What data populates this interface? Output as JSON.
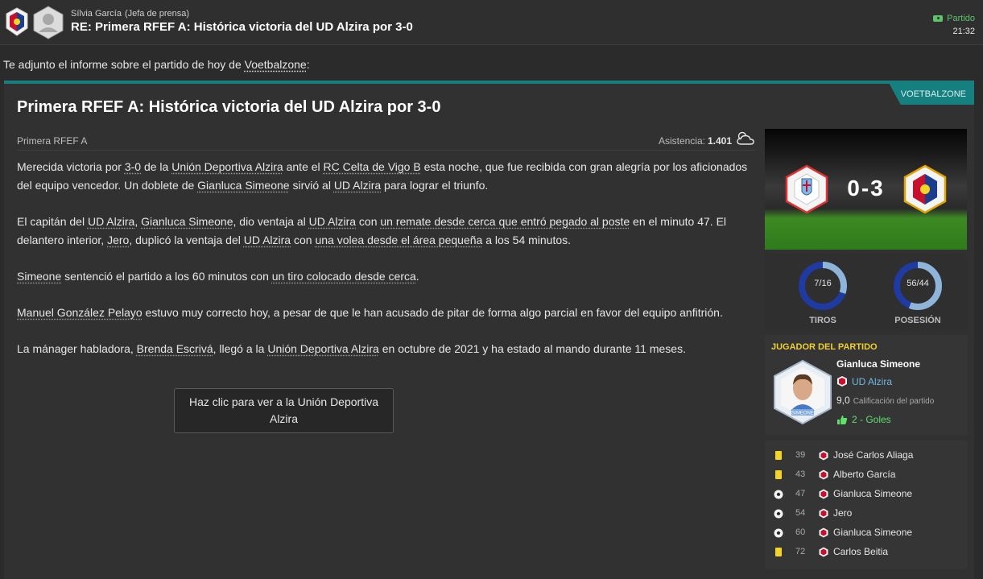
{
  "header": {
    "sender_name": "Sílvia García",
    "sender_role": "(Jefa de prensa)",
    "subject": "RE: Primera RFEF A: Histórica victoria del UD Alzira por 3-0",
    "category": "Partido",
    "time": "21:32"
  },
  "intro": {
    "prefix": "Te adjunto el informe sobre el partido de hoy de ",
    "source_link": "Voetbalzone",
    "suffix": ":"
  },
  "article": {
    "source_tab": "VOETBALZONE",
    "headline": "Primera RFEF A: Histórica victoria del UD Alzira por 3-0",
    "competition": "Primera RFEF A",
    "attendance_label": "Asistencia:",
    "attendance_value": "1.401",
    "weather_icon": "partly-cloudy-icon",
    "p1": {
      "a": "Merecida victoria por ",
      "l1": "3-0",
      "b": " de la ",
      "l2": "Unión Deportiva Alzira",
      "c": " ante el ",
      "l3": "RC Celta de Vigo B",
      "d": " esta noche, que fue recibida con gran alegría por los aficionados del equipo vencedor. Un doblete de ",
      "l4": "Gianluca Simeone",
      "e": " sirvió al ",
      "l5": "UD Alzira",
      "f": " para lograr el triunfo."
    },
    "p2": {
      "a": "El capitán del ",
      "l1": "UD Alzira",
      "b": ", ",
      "l2": "Gianluca Simeone",
      "c": ", dio ventaja al ",
      "l3": "UD Alzira",
      "d": " con ",
      "l4": "un remate desde cerca que entró pegado al poste",
      "e": " en el minuto 47. El delantero interior, ",
      "l5": "Jero",
      "f": ", duplicó la ventaja del ",
      "l6": "UD Alzira",
      "g": " con ",
      "l7": "una volea desde el área pequeña",
      "h": " a los 54 minutos."
    },
    "p3": {
      "l1": "Simeone",
      "a": " sentenció el partido a los 60 minutos con ",
      "l2": "un tiro colocado desde cerca",
      "b": "."
    },
    "p4": {
      "l1": "Manuel González Pelayo",
      "a": " estuvo muy correcto hoy, a pesar de que le han acusado de pitar de forma algo parcial en favor del equipo anfitrión."
    },
    "p5": {
      "a": "La mánager habladora, ",
      "l1": "Brenda Escrivá",
      "b": ", llegó a la ",
      "l2": "Unión Deportiva Alzira",
      "c": " en octubre de 2021 y ha estado al mando durante 11 meses."
    },
    "button_label": "Haz clic para ver a la Unión Deportiva Alzira"
  },
  "match": {
    "score": "0-3",
    "home_crest": "celta-crest-icon",
    "away_crest": "alzira-crest-icon",
    "stats": [
      {
        "label": "TIROS",
        "value": "7/16",
        "home_fraction": 0.304
      },
      {
        "label": "POSESIÓN",
        "value": "56/44",
        "home_fraction": 0.56
      }
    ]
  },
  "motm": {
    "title": "JUGADOR DEL PARTIDO",
    "name": "Gianluca Simeone",
    "club": "UD Alzira",
    "rating": "9,0",
    "rating_label": "Calificación del partido",
    "goals": "2 - Goles",
    "shirt_name": "SIMEONE"
  },
  "events": [
    {
      "type": "yellow-card-icon",
      "minute": "39",
      "player": "José Carlos Aliaga"
    },
    {
      "type": "yellow-card-icon",
      "minute": "43",
      "player": "Alberto García"
    },
    {
      "type": "goal-ball-icon",
      "minute": "47",
      "player": "Gianluca Simeone"
    },
    {
      "type": "goal-ball-icon",
      "minute": "54",
      "player": "Jero"
    },
    {
      "type": "goal-ball-icon",
      "minute": "60",
      "player": "Gianluca Simeone"
    },
    {
      "type": "yellow-card-icon",
      "minute": "72",
      "player": "Carlos Beitia"
    }
  ],
  "colors": {
    "accent_teal": "#167f7f",
    "goal_green": "#5ee06b",
    "motm_yellow": "#f0d030",
    "ring_home": "#8eb4d8",
    "ring_away": "#1f3aa0"
  }
}
